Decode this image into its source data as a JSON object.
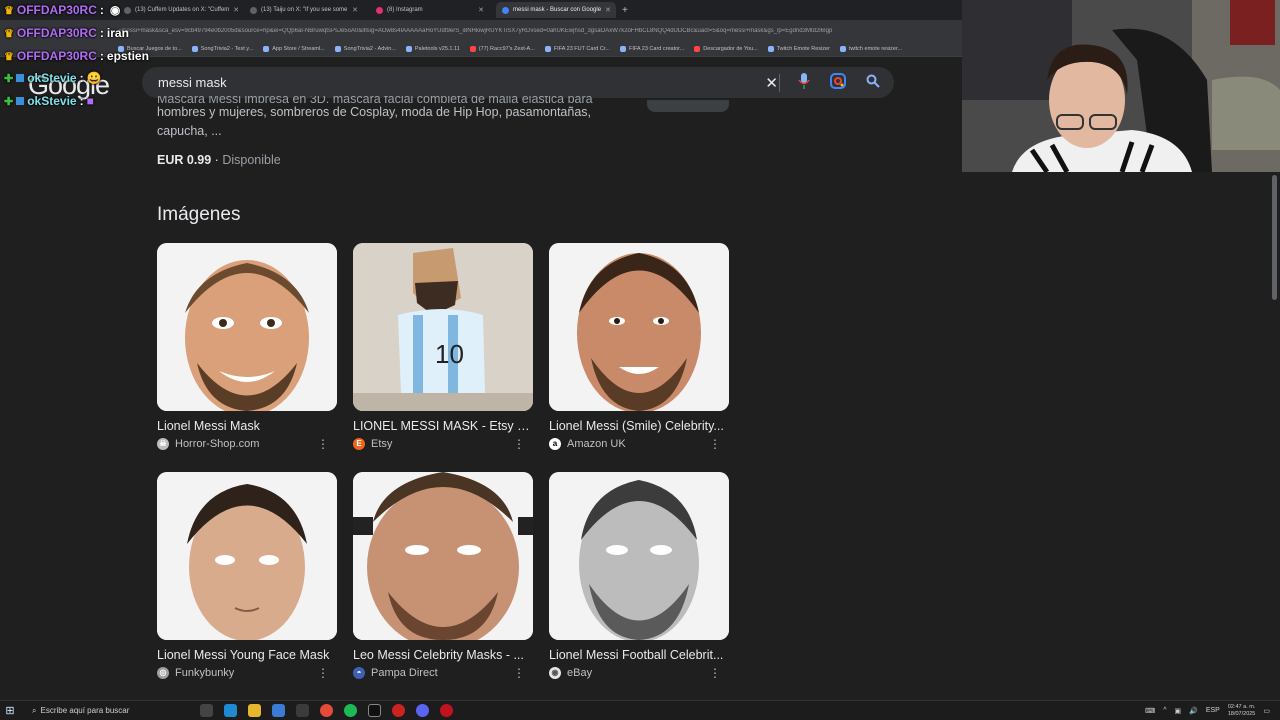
{
  "browser": {
    "tabs": [
      {
        "title": "(13) Cuffem Updates on X: \"Cuffem",
        "icon": "x-logo-icon"
      },
      {
        "title": "(13) Taiju on X: \"If you see some",
        "icon": "x-logo-icon"
      },
      {
        "title": "(8) Instagram",
        "icon": "instagram-icon"
      },
      {
        "title": "messi mask - Buscar con Google",
        "icon": "google-icon"
      }
    ],
    "url": "=messi+mask&sca_esv=9cb49794e0b2005d&source=hp&ei=QQp6aI-NBruwqtsPsJe5oA0&iflsig=AOw8s4IAAAAAaHoYUdt9erS_i8NHkiwjRUYKTiSX7yRDvsed=0ahUKEwjhsd_3gsaOAxW7k2oFHbCL8NQQ4dUDCBc&uact=5&oq=messi+mask&gs_lp=Egdnd3Mtd2l6Igp",
    "bookmarks": [
      "Buscar Juegos de to...",
      "SongTrivia2 - Test y...",
      "App Store / Streaml...",
      "SongTrivia2 - Advin...",
      "Paletools v25.1.11",
      "(77) Racc97's Zest-A...",
      "FIFA 23 FUT Card Cr...",
      "FIFA 23 Card creator...",
      "Descargador de You...",
      "Twitch Emote Resizer",
      "twitch emote resizer..."
    ]
  },
  "google": {
    "logo": "Google",
    "query": "messi mask"
  },
  "chat": [
    {
      "user": "OFFDAP30RC",
      "message": "",
      "badge": "crown"
    },
    {
      "user": "OFFDAP30RC",
      "message": "iran",
      "badge": "crown"
    },
    {
      "user": "OFFDAP30RC",
      "message": "epstien",
      "badge": "crown"
    },
    {
      "user": "okStevie",
      "message": "",
      "badge": "plus"
    },
    {
      "user": "okStevie",
      "message": "",
      "badge": "plus"
    }
  ],
  "result": {
    "snippet_cut": "Máscara Messi impresa en 3D, máscara facial completa de malla elástica para",
    "snippet": "hombres y mujeres, sombreros de Cosplay, moda de Hip Hop, pasamontañas, capucha, ...",
    "price": "EUR 0.99",
    "availability": "Disponible"
  },
  "images_section": {
    "title": "Imágenes",
    "items": [
      {
        "title": "Lionel Messi Mask",
        "source": "Horror-Shop.com",
        "favicon_color": "#bdbdbd"
      },
      {
        "title": "LIONEL MESSI MASK - Etsy M...",
        "source": "Etsy",
        "favicon_color": "#f1641e"
      },
      {
        "title": "Lionel Messi (Smile) Celebrity...",
        "source": "Amazon UK",
        "favicon_color": "#ffffff"
      },
      {
        "title": "Lionel Messi Young Face Mask",
        "source": "Funkybunky",
        "favicon_color": "#9e9e9e"
      },
      {
        "title": "Leo Messi Celebrity Masks - ...",
        "source": "Pampa Direct",
        "favicon_color": "#3f5fb5"
      },
      {
        "title": "Lionel Messi Football Celebrit...",
        "source": "eBay",
        "favicon_color": "#e6e6e6"
      }
    ]
  },
  "taskbar": {
    "search_placeholder": "Escribe aquí para buscar",
    "language": "ESP",
    "time": "02:47 a. m.",
    "date": "18/07/2025"
  }
}
